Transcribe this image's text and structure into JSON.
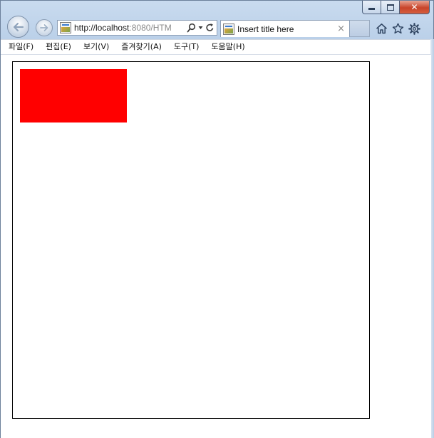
{
  "browser": {
    "address_url_host": "http://localhost",
    "address_url_rest": ":8080/HTM",
    "tab_title": "Insert title here",
    "tab_close_glyph": "×",
    "close_glyph": "✕"
  },
  "menu": {
    "items": [
      "파일(F)",
      "편집(E)",
      "보기(V)",
      "즐겨찾기(A)",
      "도구(T)",
      "도움말(H)"
    ]
  },
  "icons": {
    "back": "back-arrow-icon",
    "forward": "forward-arrow-icon",
    "search": "search-icon",
    "refresh": "refresh-icon",
    "home": "home-icon",
    "favorites": "star-icon",
    "tools": "gear-icon"
  },
  "canvas": {
    "shape_color": "#ff0000",
    "border_color": "#000000"
  }
}
